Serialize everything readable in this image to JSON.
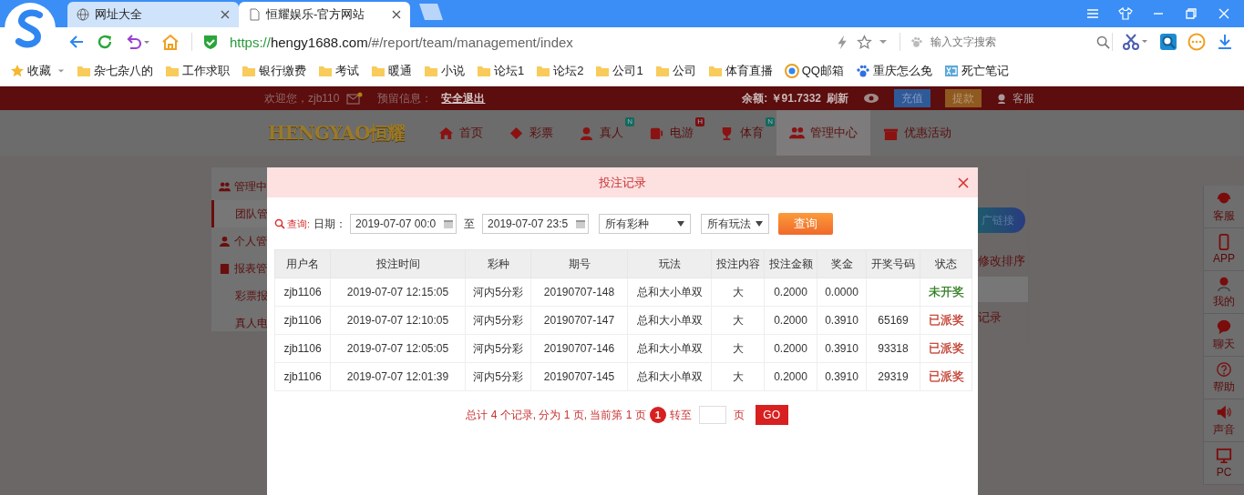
{
  "browser": {
    "tabs": [
      {
        "title": "网址大全",
        "selected": false
      },
      {
        "title": "恒耀娱乐-官方网站",
        "selected": true
      }
    ],
    "url": {
      "scheme": "https://",
      "host": "hengy1688.com",
      "path": "/#/report/team/management/index"
    },
    "search": {
      "placeholder": "输入文字搜索"
    },
    "bookmarks": [
      {
        "label": "收藏",
        "kind": "star"
      },
      {
        "label": "杂七杂八的",
        "kind": "folder"
      },
      {
        "label": "工作求职",
        "kind": "folder"
      },
      {
        "label": "银行缴费",
        "kind": "folder"
      },
      {
        "label": "考试",
        "kind": "folder"
      },
      {
        "label": "暖通",
        "kind": "folder"
      },
      {
        "label": "小说",
        "kind": "folder"
      },
      {
        "label": "论坛1",
        "kind": "folder"
      },
      {
        "label": "论坛2",
        "kind": "folder"
      },
      {
        "label": "公司1",
        "kind": "folder"
      },
      {
        "label": "公司",
        "kind": "folder"
      },
      {
        "label": "体育直播",
        "kind": "folder"
      },
      {
        "label": "QQ邮箱",
        "kind": "mail"
      },
      {
        "label": "重庆怎么免",
        "kind": "paw"
      },
      {
        "label": "死亡笔记",
        "kind": "tile"
      }
    ]
  },
  "site": {
    "topbar": {
      "welcome": "欢迎您，zjb110",
      "reserved_label": "预留信息：",
      "logout": "安全退出",
      "balance": "余额: ￥91.7332",
      "refresh": "刷新",
      "deposit": "充值",
      "withdraw": "提款",
      "service": "客服"
    },
    "logo": "HENGYAO恒耀",
    "nav": [
      {
        "label": "首页",
        "selected": false
      },
      {
        "label": "彩票",
        "selected": false
      },
      {
        "label": "真人",
        "badge": "N",
        "selected": false
      },
      {
        "label": "电游",
        "badge": "H",
        "selected": false
      },
      {
        "label": "体育",
        "badge": "N",
        "selected": false
      },
      {
        "label": "管理中心",
        "selected": true
      },
      {
        "label": "优惠活动",
        "selected": false
      }
    ],
    "sidebar": [
      {
        "label": "管理中",
        "kind": "heading",
        "selected": false
      },
      {
        "label": "团队管",
        "kind": "sub",
        "selected": true
      },
      {
        "label": "个人管",
        "kind": "heading",
        "selected": false
      },
      {
        "label": "报表管",
        "kind": "heading",
        "selected": false
      },
      {
        "label": "彩票报",
        "kind": "sub",
        "selected": false
      },
      {
        "label": "真人电",
        "kind": "sub",
        "selected": false
      }
    ],
    "right_panel": {
      "link_button": "广链接",
      "sort_link": "修改排序",
      "record_link": "记录"
    },
    "float_bar": [
      {
        "label": "客服"
      },
      {
        "label": "APP"
      },
      {
        "label": "我的"
      },
      {
        "label": "聊天"
      },
      {
        "label": "帮助"
      },
      {
        "label": "声音"
      },
      {
        "label": "PC"
      }
    ]
  },
  "modal": {
    "title": "投注记录",
    "filter": {
      "query_label": "查询:",
      "date_label": "日期：",
      "date_from": "2019-07-07 00:0",
      "to_label": "至",
      "date_to": "2019-07-07 23:5",
      "lottery_select": "所有彩种",
      "play_select": "所有玩法",
      "query_button": "查询"
    },
    "table": {
      "columns": [
        "用户名",
        "投注时间",
        "彩种",
        "期号",
        "玩法",
        "投注内容",
        "投注金额",
        "奖金",
        "开奖号码",
        "状态"
      ],
      "rows": [
        {
          "user": "zjb1106",
          "time": "2019-07-07 12:15:05",
          "lottery": "河内5分彩",
          "issue": "20190707-148",
          "play": "总和大小单双",
          "content": "大",
          "amount": "0.2000",
          "prize": "0.0000",
          "status": "未开奖",
          "color": "#2e7d1e"
        },
        {
          "user": "zjb1106",
          "time": "2019-07-07 12:10:05",
          "lottery": "河内5分彩",
          "issue": "20190707-147",
          "play": "总和大小单双",
          "content": "大",
          "amount": "0.2000",
          "prize": "0.3910",
          "draw_number": "65169",
          "status": "已派奖",
          "color": "#c0392b"
        },
        {
          "user": "zjb1106",
          "time": "2019-07-07 12:05:05",
          "lottery": "河内5分彩",
          "issue": "20190707-146",
          "play": "总和大小单双",
          "content": "大",
          "amount": "0.2000",
          "prize": "0.3910",
          "draw_number": "93318",
          "status": "已派奖",
          "color": "#c0392b"
        },
        {
          "user": "zjb1106",
          "time": "2019-07-07 12:01:39",
          "lottery": "河内5分彩",
          "issue": "20190707-145",
          "play": "总和大小单双",
          "content": "大",
          "amount": "0.2000",
          "prize": "0.3910",
          "draw_number": "29319",
          "status": "已派奖",
          "color": "#c0392b"
        }
      ]
    },
    "pagination": {
      "summary": "总计 4 个记录, 分为 1 页, 当前第 1 页",
      "current": "1",
      "goto": "转至",
      "page_unit": "页",
      "go": "GO"
    }
  }
}
